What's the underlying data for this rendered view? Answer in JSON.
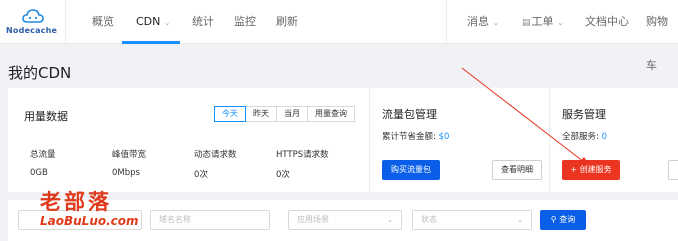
{
  "brand": {
    "name": "Nodecache"
  },
  "nav": {
    "left": [
      {
        "label": "概览"
      },
      {
        "label": "CDN"
      },
      {
        "label": "统计"
      },
      {
        "label": "监控"
      },
      {
        "label": "刷新"
      }
    ],
    "active_index": 1,
    "right": [
      {
        "label": "消息"
      },
      {
        "label": "工单"
      },
      {
        "label": "文档中心"
      },
      {
        "label": "购物车"
      }
    ]
  },
  "page": {
    "title": "我的CDN"
  },
  "usage": {
    "title": "用量数据",
    "ranges": [
      "今天",
      "昨天",
      "当月",
      "用量查询"
    ],
    "active_range": 0,
    "stats": [
      {
        "label": "总流量",
        "value": "0GB"
      },
      {
        "label": "峰值带宽",
        "value": "0Mbps"
      },
      {
        "label": "动态请求数",
        "value": "0次"
      },
      {
        "label": "HTTPS请求数",
        "value": "0次"
      }
    ]
  },
  "traffic_pack": {
    "title": "流量包管理",
    "savings_label": "累计节省金额:",
    "savings_value": "$0",
    "buy_button": "购买流量包",
    "detail_button": "查看明细"
  },
  "service": {
    "title": "服务管理",
    "total_label": "全部服务:",
    "total_value": "0",
    "create_button": "+ 创建服务"
  },
  "filters": {
    "domain_placeholder": "域名名称",
    "scene_placeholder": "应用场景",
    "status_placeholder": "状态",
    "search_button": "查询"
  },
  "watermark": {
    "cn": "老部落",
    "en": "LaoBuLuo.com"
  },
  "colors": {
    "accent": "#1890ff",
    "primary_button": "#0a5ee8",
    "danger_button": "#ea3620",
    "annotation": "#e8341f"
  }
}
